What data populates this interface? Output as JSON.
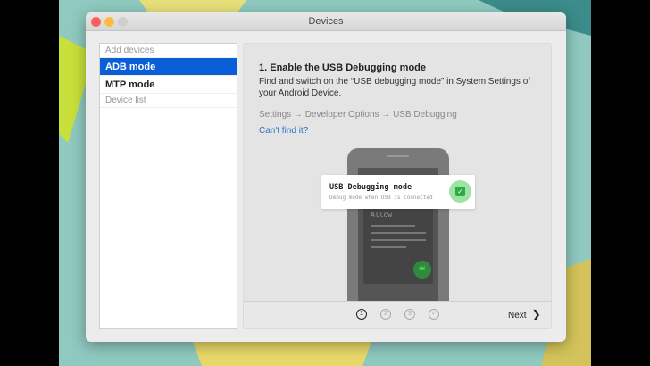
{
  "window": {
    "title": "Devices"
  },
  "sidebar": {
    "sections": [
      {
        "label": "Add devices",
        "items": [
          {
            "label": "ADB mode",
            "selected": true
          },
          {
            "label": "MTP mode",
            "selected": false
          }
        ]
      },
      {
        "label": "Device list",
        "items": []
      }
    ]
  },
  "main": {
    "heading": "1. Enable the USB Debugging mode",
    "description": "Find and switch on the “USB debugging mode” in System Settings of your Android Device.",
    "path": "Settings → Developer Options → USB Debugging",
    "help_link": "Can't find it?",
    "illustration": {
      "card_title": "USB Debugging mode",
      "card_subtitle": "Debug mode when USB is connected",
      "dialog_title": "Allow",
      "ok_label": "OK"
    },
    "steps": [
      "1",
      "2",
      "3",
      "✓"
    ],
    "current_step": 1,
    "next_label": "Next",
    "next_icon": "chevron-right-icon"
  },
  "colors": {
    "accent": "#0a5fd6",
    "link": "#2a72c9",
    "check": "#2dab46"
  }
}
